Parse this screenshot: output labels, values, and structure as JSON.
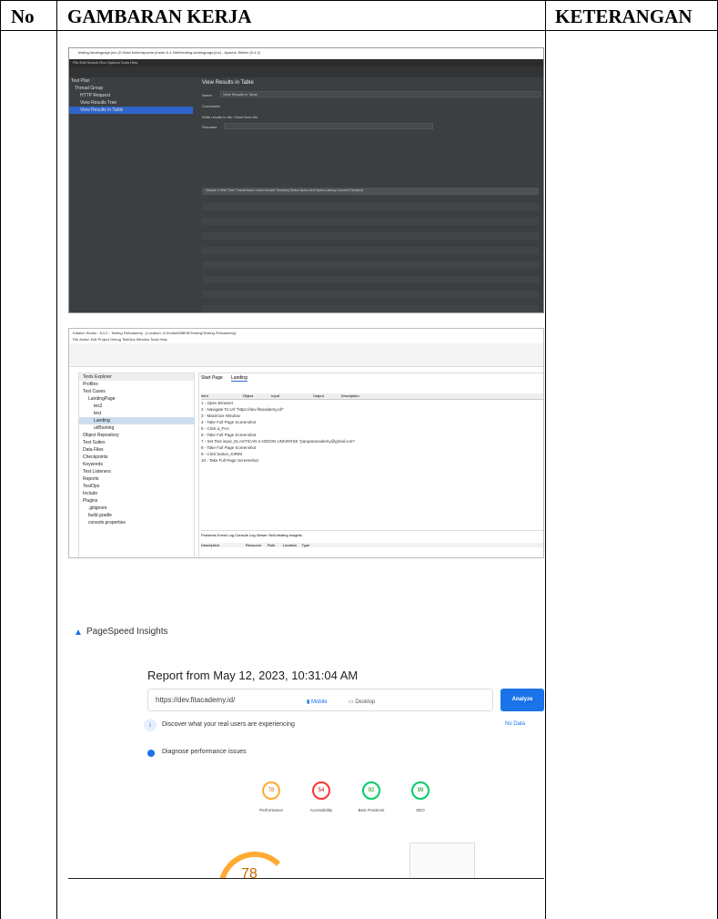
{
  "table": {
    "col_no": "No",
    "col_gambaran": "GAMBARAN KERJA",
    "col_keterangan": "KETERANGAN"
  },
  "jmeter": {
    "title": "testing-landingpage.jmx (D:\\New folder\\apache-jmeter-5.4.3\\bin\\testing-landingpage.jmx) - Apache JMeter (5.4.3)",
    "menu": "File  Edit  Search  Run  Options  Tools  Help",
    "tree": [
      "Test Plan",
      "Thread Group",
      "HTTP Request",
      "View Results Tree",
      "View Results in Table"
    ],
    "panel_title": "View Results in Table",
    "name_label": "Name:",
    "name_value": "View Results in Table",
    "comments_label": "Comments:",
    "write_label": "Write results to file / Read from file",
    "filename_label": "Filename",
    "columns": "Sample #    Start Time    Thread Name    Label    Sample Time(ms)    Status    Bytes    Sent Bytes    Latency    Connect Time(ms)"
  },
  "katalon": {
    "title": "Katalon Studio - 8.4.0 - Testing FitAcademy - [Location: D:\\Kuliah\\MBKM\\Testing\\Testing FitAcademy]",
    "menu": "File  Action  Edit  Project  Debug  TestOps  Window  Tools  Help",
    "explorer_title": "Tests Explorer",
    "tree": [
      "Profiles",
      "Test Cases",
      "LandingPage",
      "tes2",
      "test",
      "Landing",
      "ui/Booting",
      "Object Repository",
      "Test Suites",
      "Data Files",
      "Checkpoints",
      "Keywords",
      "Test Listeners",
      "Reports",
      "TestOps",
      "Include",
      "Plugins",
      ".gitignore",
      "build.gradle",
      "console.properties"
    ],
    "tab_start": "Start Page",
    "tab_landing": "Landing",
    "columns": "Item                                  Object                  Input                                 Output                 Description",
    "steps": [
      "1 - Open Browser",
      "2 - Navigate To Url                        \"https://dev.fitacademy.id/\"",
      "3 - Maximize Window",
      "4 - Take Full Page Screenshot",
      "5 - Click                   a_FAA",
      "6 - Take Full Page Screenshot",
      "7 - Set Text                input_ELASTICAN 3 ADDON UNIVERSE   \"panpanacademy@gmail.com\"",
      "8 - Take Full Page Screenshot",
      "9 - Click                   button_KIRIM",
      "10 - Take Full Page Screenshot"
    ],
    "bottom_tabs": "Problems   Event Log   Console   Log Viewer   Self-Healing Insights",
    "problems_cols": "Description                          Resource      Path        Location     Type"
  },
  "pagespeed": {
    "logo": "PageSpeed Insights",
    "report": "Report from May 12, 2023, 10:31:04 AM",
    "url": "https://dev.fitacademy.id/",
    "analyze": "Analyze",
    "mobile": "Mobile",
    "desktop": "Desktop",
    "real_users": "Discover what your real users are experiencing",
    "no_data": "No Data",
    "diagnose": "Diagnose performance issues",
    "scores": [
      {
        "value": "78",
        "label": "Performance",
        "color": "#fa3"
      },
      {
        "value": "54",
        "label": "Accessibility",
        "color": "#f33"
      },
      {
        "value": "92",
        "label": "Best Practices",
        "color": "#0c6"
      },
      {
        "value": "99",
        "label": "SEO",
        "color": "#0c6"
      }
    ],
    "big_score": "78"
  }
}
